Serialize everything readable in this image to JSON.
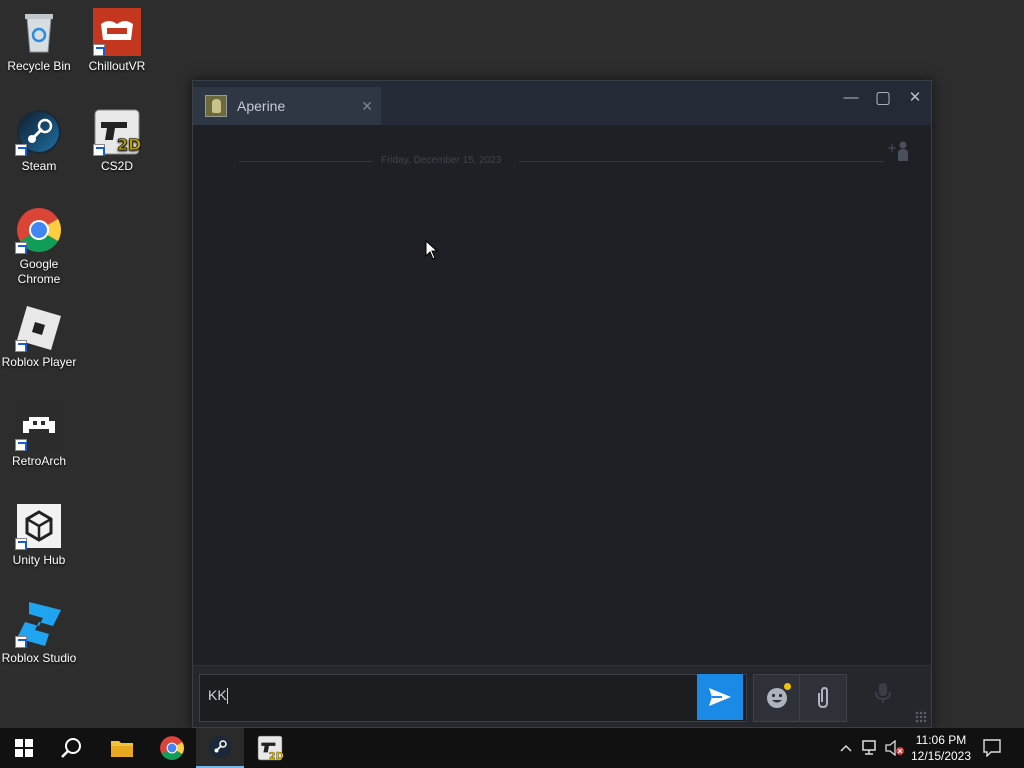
{
  "desktop": {
    "icons": [
      {
        "label": "Recycle Bin"
      },
      {
        "label": "ChilloutVR"
      },
      {
        "label": "Steam"
      },
      {
        "label": "CS2D"
      },
      {
        "label": "Google Chrome"
      },
      {
        "label": "Roblox Player"
      },
      {
        "label": "RetroArch"
      },
      {
        "label": "Unity Hub"
      },
      {
        "label": "Roblox Studio"
      }
    ]
  },
  "chat_window": {
    "tab_name": "Aperine",
    "tab_close": "✕",
    "minimize": "—",
    "maximize": "▢",
    "close": "✕",
    "date_divider": "Friday, December 15, 2023",
    "input_value": "KK",
    "colors": {
      "send_button": "#1a8ae6",
      "notification_dot": "#f2c200",
      "window_bg": "#1f2126"
    }
  },
  "taskbar": {
    "apps": [
      "start",
      "search",
      "file-explorer",
      "chrome",
      "steam",
      "cs2d"
    ],
    "active_app": "steam",
    "clock_time": "11:06 PM",
    "clock_date": "12/15/2023"
  }
}
